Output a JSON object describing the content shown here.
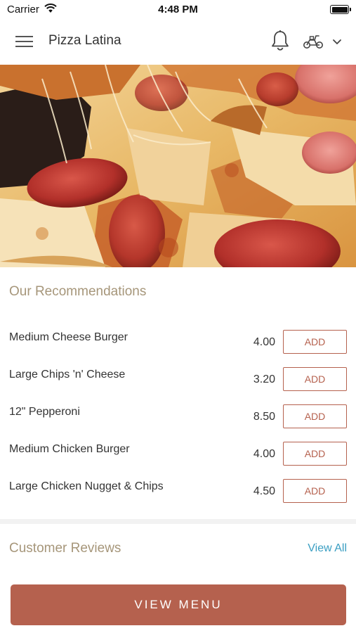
{
  "status_bar": {
    "carrier": "Carrier",
    "time": "4:48 PM"
  },
  "header": {
    "title": "Pizza Latina",
    "icons": {
      "menu": "hamburger-icon",
      "notifications": "bell-icon",
      "delivery": "scooter-icon",
      "dropdown": "chevron-down-icon"
    }
  },
  "recommendations": {
    "title": "Our Recommendations",
    "items": [
      {
        "name": "Medium Cheese Burger",
        "price": "4.00",
        "button": "ADD"
      },
      {
        "name": "Large Chips 'n' Cheese",
        "price": "3.20",
        "button": "ADD"
      },
      {
        "name": "12\" Pepperoni",
        "price": "8.50",
        "button": "ADD"
      },
      {
        "name": "Medium Chicken Burger",
        "price": "4.00",
        "button": "ADD"
      },
      {
        "name": "Large Chicken Nugget & Chips",
        "price": "4.50",
        "button": "ADD"
      }
    ]
  },
  "reviews": {
    "title": "Customer Reviews",
    "link": "View All"
  },
  "cta": {
    "label": "VIEW MENU"
  },
  "colors": {
    "accent": "#b5614e",
    "section_title": "#a6967a",
    "link": "#3a9ec2"
  }
}
